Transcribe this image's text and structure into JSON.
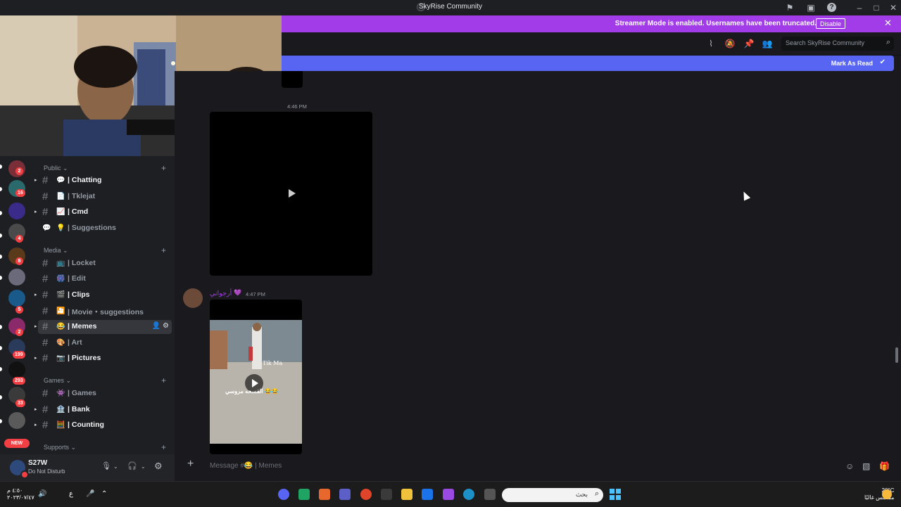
{
  "window": {
    "title": "SkyRise Community",
    "controls": {
      "minimize": "–",
      "maximize": "□",
      "close": "✕"
    }
  },
  "streamer_banner": {
    "message": "Streamer Mode is enabled. Usernames have been truncated.",
    "button": "Disable"
  },
  "header": {
    "search_placeholder": "Search SkyRise Community",
    "icons": [
      "threads-icon",
      "mute-bell-icon",
      "pin-icon",
      "members-icon"
    ]
  },
  "unread_bar": {
    "label": "Mark As Read"
  },
  "servers": {
    "badges": [
      "2",
      "16",
      "4",
      "8",
      "5",
      "2",
      "199",
      "293",
      "33"
    ],
    "new_pill": "NEW"
  },
  "sidebar": {
    "categories": [
      {
        "name": "Public",
        "channels": [
          {
            "emoji": "💬",
            "name": "| Chatting",
            "unread": true,
            "icon": "#"
          },
          {
            "emoji": "📄",
            "name": "| Tklejat",
            "unread": false,
            "icon": "#"
          },
          {
            "emoji": "📈",
            "name": "| Cmd",
            "unread": true,
            "icon": "#"
          },
          {
            "emoji": "💡",
            "name": "| Suggestions",
            "unread": false,
            "icon": "💬"
          }
        ]
      },
      {
        "name": "Media",
        "channels": [
          {
            "emoji": "📺",
            "name": "| Locket",
            "unread": false,
            "icon": "#"
          },
          {
            "emoji": "🎆",
            "name": "| Edit",
            "unread": false,
            "icon": "#"
          },
          {
            "emoji": "🎬",
            "name": "| Clips",
            "unread": true,
            "icon": "#"
          },
          {
            "emoji": "🎦",
            "name": "| Movie・suggestions",
            "unread": false,
            "icon": "#"
          },
          {
            "emoji": "😂",
            "name": "| Memes",
            "unread": true,
            "icon": "#",
            "selected": true
          },
          {
            "emoji": "🎨",
            "name": "| Art",
            "unread": false,
            "icon": "#"
          },
          {
            "emoji": "📷",
            "name": "| Pictures",
            "unread": true,
            "icon": "#"
          }
        ]
      },
      {
        "name": "Games",
        "channels": [
          {
            "emoji": "👾",
            "name": "| Games",
            "unread": false,
            "icon": "#"
          },
          {
            "emoji": "🏦",
            "name": "| Bank",
            "unread": true,
            "icon": "#"
          },
          {
            "emoji": "🧮",
            "name": "| Counting",
            "unread": true,
            "icon": "#"
          }
        ]
      },
      {
        "name": "Supports",
        "channels": []
      }
    ]
  },
  "user": {
    "name": "S27W",
    "status": "Do Not Disturb"
  },
  "messages": [
    {
      "time": "4:46 PM"
    },
    {
      "author": "أرجواني",
      "badge": "💜",
      "time": "4:47 PM",
      "video_text": "Tik Ma",
      "caption": "الفسحه مروسي 😂😂"
    }
  ],
  "composer": {
    "placeholder": "Message #😂 | Memes"
  },
  "taskbar": {
    "time": "٤:٥٠ م",
    "date": "٢٠٢٣/٠٧/٤٧",
    "lang": "ع",
    "search": "بحث",
    "weather_temp": "20°C",
    "weather_desc": "مشمس غالبًا"
  }
}
